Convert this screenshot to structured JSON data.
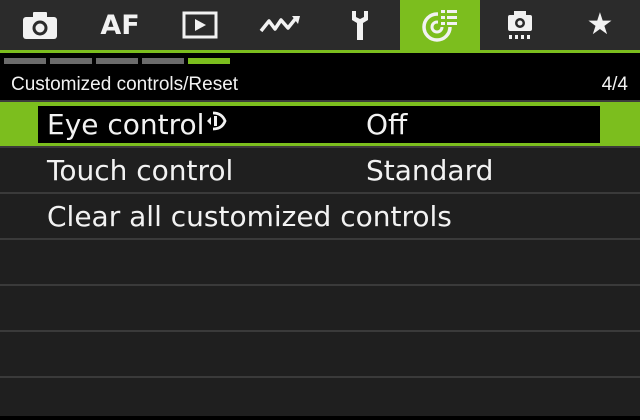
{
  "tabs": [
    {
      "icon": "camera-icon",
      "active": false
    },
    {
      "icon": "af-icon",
      "label": "AF",
      "active": false
    },
    {
      "icon": "playback-icon",
      "active": false
    },
    {
      "icon": "wireless-icon",
      "active": false
    },
    {
      "icon": "wrench-icon",
      "active": false
    },
    {
      "icon": "custom-functions-icon",
      "active": true
    },
    {
      "icon": "sensor-cleaning-icon",
      "active": false
    },
    {
      "icon": "star-icon",
      "label": "★",
      "active": false
    }
  ],
  "page_indicator": {
    "count": 5,
    "active_index": 4
  },
  "header": {
    "title": "Customized controls/Reset",
    "page": "4/4"
  },
  "rows": [
    {
      "label": "Eye control",
      "value": "Off",
      "selected": true,
      "icon": "eye-control-icon"
    },
    {
      "label": "Touch control",
      "value": "Standard",
      "selected": false
    },
    {
      "label": "Clear all customized controls",
      "value": "",
      "selected": false
    },
    {
      "label": "",
      "value": "",
      "selected": false
    },
    {
      "label": "",
      "value": "",
      "selected": false
    },
    {
      "label": "",
      "value": "",
      "selected": false
    },
    {
      "label": "",
      "value": "",
      "selected": false
    }
  ],
  "colors": {
    "accent": "#7cbe1e",
    "background": "#000000",
    "row": "#1f1f1f"
  }
}
